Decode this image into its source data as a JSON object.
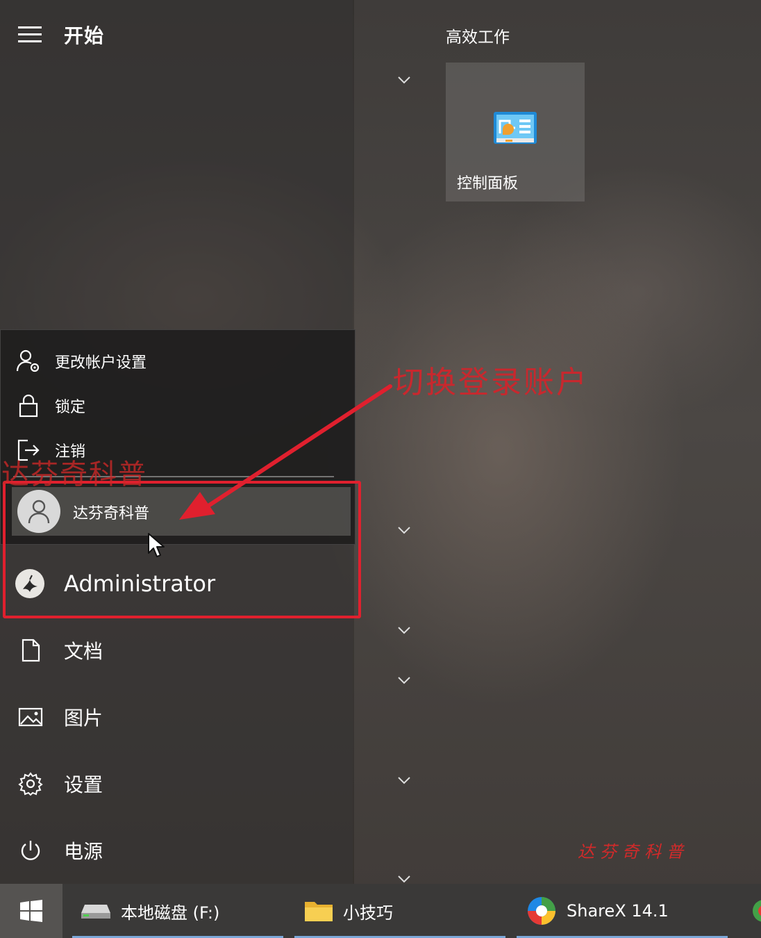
{
  "start_menu": {
    "title": "开始",
    "tile_group_title": "高效工作",
    "tile": {
      "label": "控制面板",
      "icon": "control-panel-icon"
    }
  },
  "account_flyout": {
    "items": [
      {
        "label": "更改帐户设置",
        "icon": "user-settings-icon"
      },
      {
        "label": "锁定",
        "icon": "lock-icon"
      },
      {
        "label": "注销",
        "icon": "sign-out-icon"
      }
    ],
    "current_user": {
      "name": "达芬奇科普",
      "icon": "user-avatar-icon"
    },
    "other_user": {
      "name": "Administrator",
      "icon": "bird-avatar-icon"
    }
  },
  "nav": {
    "items": [
      {
        "label": "文档",
        "icon": "document-icon"
      },
      {
        "label": "图片",
        "icon": "pictures-icon"
      },
      {
        "label": "设置",
        "icon": "gear-icon"
      },
      {
        "label": "电源",
        "icon": "power-icon"
      }
    ]
  },
  "annotations": {
    "callout": "切换登录账户",
    "watermark_left": "达芬奇科普",
    "watermark_seal": "达芬奇科普",
    "highlight_color": "#e0202e"
  },
  "taskbar": {
    "items": [
      {
        "label": "本地磁盘 (F:)",
        "icon": "drive-icon"
      },
      {
        "label": "小技巧",
        "icon": "folder-icon"
      },
      {
        "label": "ShareX 14.1",
        "icon": "sharex-icon"
      }
    ],
    "accent_color": "#7aa7d8"
  }
}
